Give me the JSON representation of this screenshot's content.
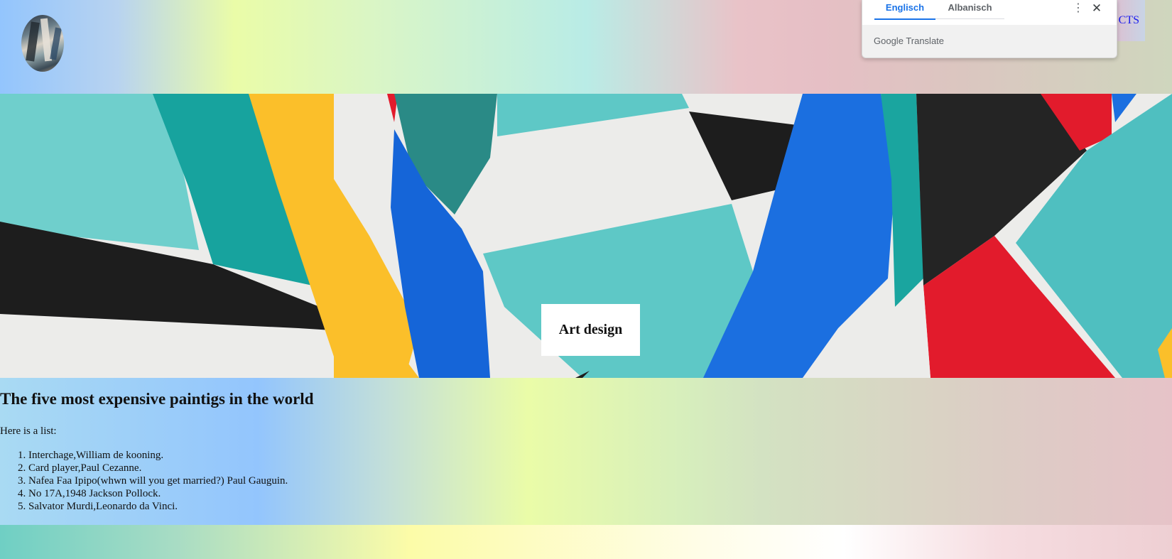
{
  "header": {
    "logo_alt": "abstract painting logo",
    "nav": {
      "link_a": "",
      "link_b": "",
      "link_c": "CTS"
    }
  },
  "translate_popup": {
    "tab_source": "Englisch",
    "tab_target": "Albanisch",
    "more_icon": "more-vertical-icon",
    "close_icon": "close-icon",
    "brand_google": "Google",
    "brand_translate": "Translate"
  },
  "hero": {
    "label": "Art design",
    "colors": {
      "teal": "#5ec8c6",
      "dark_teal": "#16a09c",
      "yellow": "#fbbf2a",
      "blue": "#1565d8",
      "black": "#1d1d1d",
      "red": "#e21b2c",
      "white": "#ececea"
    }
  },
  "main": {
    "heading": "The five most expensive paintigs in the world",
    "intro": "Here is a list:",
    "items": [
      "Interchage,William de kooning.",
      "Card player,Paul Cezanne.",
      "Nafea Faa Ipipo(whwn will you get married?) Paul Gauguin.",
      "No 17A,1948 Jackson Pollock.",
      "Salvator Murdi,Leonardo da Vinci."
    ]
  }
}
